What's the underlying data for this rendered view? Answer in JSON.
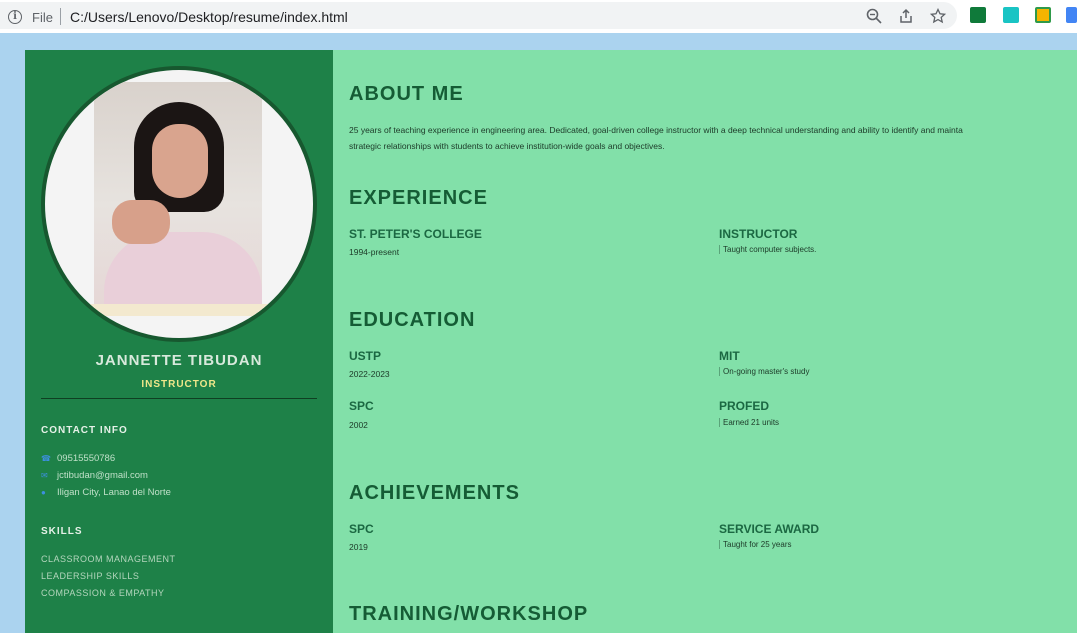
{
  "browser": {
    "file_label": "File",
    "url": "C:/Users/Lenovo/Desktop/resume/index.html"
  },
  "profile": {
    "name": "JANNETTE TIBUDAN",
    "role": "INSTRUCTOR"
  },
  "contact": {
    "heading": "CONTACT INFO",
    "phone": "09515550786",
    "email": "jctibudan@gmail.com",
    "address": "Iligan City, Lanao del Norte"
  },
  "skills": {
    "heading": "SKILLS",
    "items": [
      "CLASSROOM MANAGEMENT",
      "LEADERSHIP SKILLS",
      "COMPASSION & EMPATHY"
    ]
  },
  "about": {
    "heading": "ABOUT ME",
    "line1": "25 years of teaching experience in engineering area. Dedicated, goal-driven college instructor with a deep technical understanding and ability to identify and mainta",
    "line2": "strategic relationships with students to achieve institution-wide goals and objectives."
  },
  "experience": {
    "heading": "EXPERIENCE",
    "left_title": "ST. PETER'S COLLEGE",
    "left_sub": "1994-present",
    "right_title": "INSTRUCTOR",
    "right_desc": "Taught computer subjects."
  },
  "education": {
    "heading": "EDUCATION",
    "items": [
      {
        "title": "USTP",
        "sub": "2022-2023"
      },
      {
        "title": "MIT",
        "desc": "On-going master's study"
      },
      {
        "title": "SPC",
        "sub": "2002"
      },
      {
        "title": "PROFED",
        "desc": "Earned 21 units"
      }
    ]
  },
  "achievements": {
    "heading": "ACHIEVEMENTS",
    "left_title": "SPC",
    "left_sub": "2019",
    "right_title": "SERVICE AWARD",
    "right_desc": "Taught for 25 years"
  },
  "training": {
    "heading": "TRAINING/WORKSHOP"
  },
  "icons": {
    "info": "info-icon",
    "zoom": "zoom-out-icon",
    "share": "share-icon",
    "star": "bookmark-star-icon",
    "phone": "phone-icon",
    "email": "envelope-icon",
    "location": "map-pin-icon"
  },
  "colors": {
    "sidebar": "#1e8148",
    "main": "#82e0a9",
    "heading": "#155c35",
    "role": "#f0e78a"
  }
}
